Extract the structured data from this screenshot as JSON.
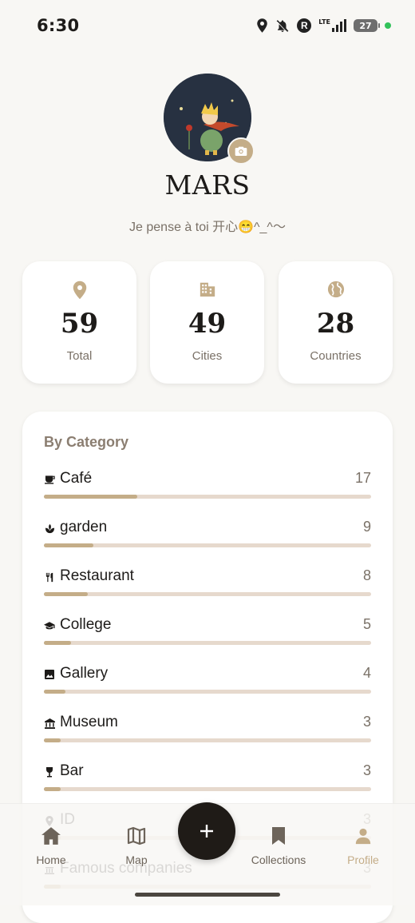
{
  "status_bar": {
    "time": "6:30",
    "network": "LTE",
    "battery": "27"
  },
  "profile": {
    "name": "MARS",
    "bio": "Je pense à toi 开心😁^_^～"
  },
  "stats": [
    {
      "icon": "location-pin-icon",
      "value": "59",
      "label": "Total"
    },
    {
      "icon": "building-icon",
      "value": "49",
      "label": "Cities"
    },
    {
      "icon": "globe-icon",
      "value": "28",
      "label": "Countries"
    }
  ],
  "categories": {
    "heading": "By Category",
    "items": [
      {
        "icon": "cafe-icon",
        "name": "Café",
        "count": "17",
        "fraction": 0.286
      },
      {
        "icon": "garden-icon",
        "name": "garden",
        "count": "9",
        "fraction": 0.15
      },
      {
        "icon": "restaurant-icon",
        "name": "Restaurant",
        "count": "8",
        "fraction": 0.135
      },
      {
        "icon": "college-icon",
        "name": "College",
        "count": "5",
        "fraction": 0.084
      },
      {
        "icon": "gallery-icon",
        "name": "Gallery",
        "count": "4",
        "fraction": 0.067
      },
      {
        "icon": "museum-icon",
        "name": "Museum",
        "count": "3",
        "fraction": 0.05
      },
      {
        "icon": "bar-icon",
        "name": "Bar",
        "count": "3",
        "fraction": 0.05
      },
      {
        "icon": "location-pin-icon",
        "name": "ID",
        "count": "3",
        "fraction": 0.05
      },
      {
        "icon": "company-icon",
        "name": "Famous companies",
        "count": "3",
        "fraction": 0.05
      }
    ]
  },
  "nav": {
    "items": [
      {
        "icon": "home-icon",
        "label": "Home",
        "active": false
      },
      {
        "icon": "map-icon",
        "label": "Map",
        "active": false
      },
      {
        "icon": "bookmark-icon",
        "label": "Collections",
        "active": false
      },
      {
        "icon": "person-icon",
        "label": "Profile",
        "active": true
      }
    ],
    "fab_icon": "plus-icon"
  },
  "colors": {
    "accent": "#c4ad88",
    "bar_track": "#e6d9cd",
    "background": "#f8f7f4",
    "fab": "#1f1b17",
    "text_muted": "#7a7167"
  }
}
